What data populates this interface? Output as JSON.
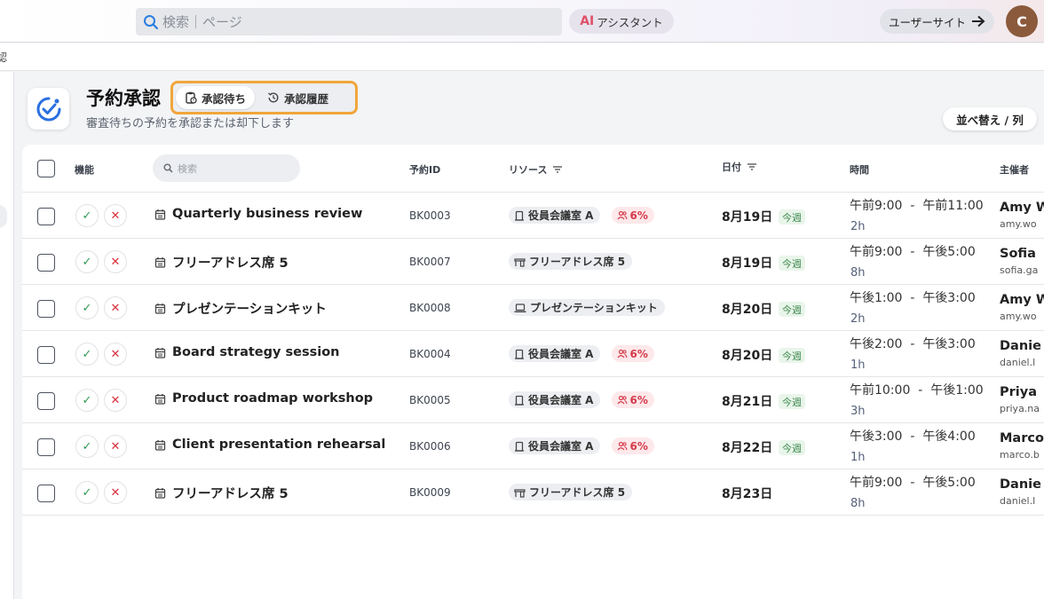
{
  "topbar": {
    "search_placeholder": "検索｜ページ",
    "ai_prefix": "AI",
    "ai_label": "アシスタント",
    "user_site_label": "ユーザーサイト",
    "avatar_initial": "C"
  },
  "breadcrumb": "認",
  "header": {
    "title": "予約承認",
    "subtitle": "審査待ちの予約を承認または却下します",
    "tabs": [
      {
        "label": "承認待ち",
        "active": true
      },
      {
        "label": "承認履歴",
        "active": false
      }
    ],
    "sort_label": "並べ替え / 列"
  },
  "table": {
    "columns": {
      "actions": "機能",
      "search_placeholder": "検索",
      "booking_id": "予約ID",
      "resource": "リソース",
      "date": "日付",
      "time": "時間",
      "host": "主催者"
    },
    "rows": [
      {
        "name": "Quarterly business review",
        "id": "BK0003",
        "resource": "役員会議室 A",
        "resource_icon": "door-icon",
        "percent": "6%",
        "date": "8月19日",
        "week": "今週",
        "start": "午前9:00",
        "end": "午前11:00",
        "duration": "2h",
        "host": "Amy W",
        "email": "amy.wo"
      },
      {
        "name": "フリーアドレス席 5",
        "id": "BK0007",
        "resource": "フリーアドレス席 5",
        "resource_icon": "desk-icon",
        "percent": "",
        "date": "8月19日",
        "week": "今週",
        "start": "午前9:00",
        "end": "午後5:00",
        "duration": "8h",
        "host": "Sofia",
        "email": "sofia.ga"
      },
      {
        "name": "プレゼンテーションキット",
        "id": "BK0008",
        "resource": "プレゼンテーションキット",
        "resource_icon": "laptop-icon",
        "percent": "",
        "date": "8月20日",
        "week": "今週",
        "start": "午後1:00",
        "end": "午後3:00",
        "duration": "2h",
        "host": "Amy W",
        "email": "amy.wo"
      },
      {
        "name": "Board strategy session",
        "id": "BK0004",
        "resource": "役員会議室 A",
        "resource_icon": "door-icon",
        "percent": "6%",
        "date": "8月20日",
        "week": "今週",
        "start": "午後2:00",
        "end": "午後3:00",
        "duration": "1h",
        "host": "Danie",
        "email": "daniel.l"
      },
      {
        "name": "Product roadmap workshop",
        "id": "BK0005",
        "resource": "役員会議室 A",
        "resource_icon": "door-icon",
        "percent": "6%",
        "date": "8月21日",
        "week": "今週",
        "start": "午前10:00",
        "end": "午後1:00",
        "duration": "3h",
        "host": "Priya",
        "email": "priya.na"
      },
      {
        "name": "Client presentation rehearsal",
        "id": "BK0006",
        "resource": "役員会議室 A",
        "resource_icon": "door-icon",
        "percent": "6%",
        "date": "8月22日",
        "week": "今週",
        "start": "午後3:00",
        "end": "午後4:00",
        "duration": "1h",
        "host": "Marco",
        "email": "marco.b"
      },
      {
        "name": "フリーアドレス席 5",
        "id": "BK0009",
        "resource": "フリーアドレス席 5",
        "resource_icon": "desk-icon",
        "percent": "",
        "date": "8月23日",
        "week": "",
        "start": "午前9:00",
        "end": "午後5:00",
        "duration": "8h",
        "host": "Danie",
        "email": "daniel.l"
      }
    ]
  }
}
